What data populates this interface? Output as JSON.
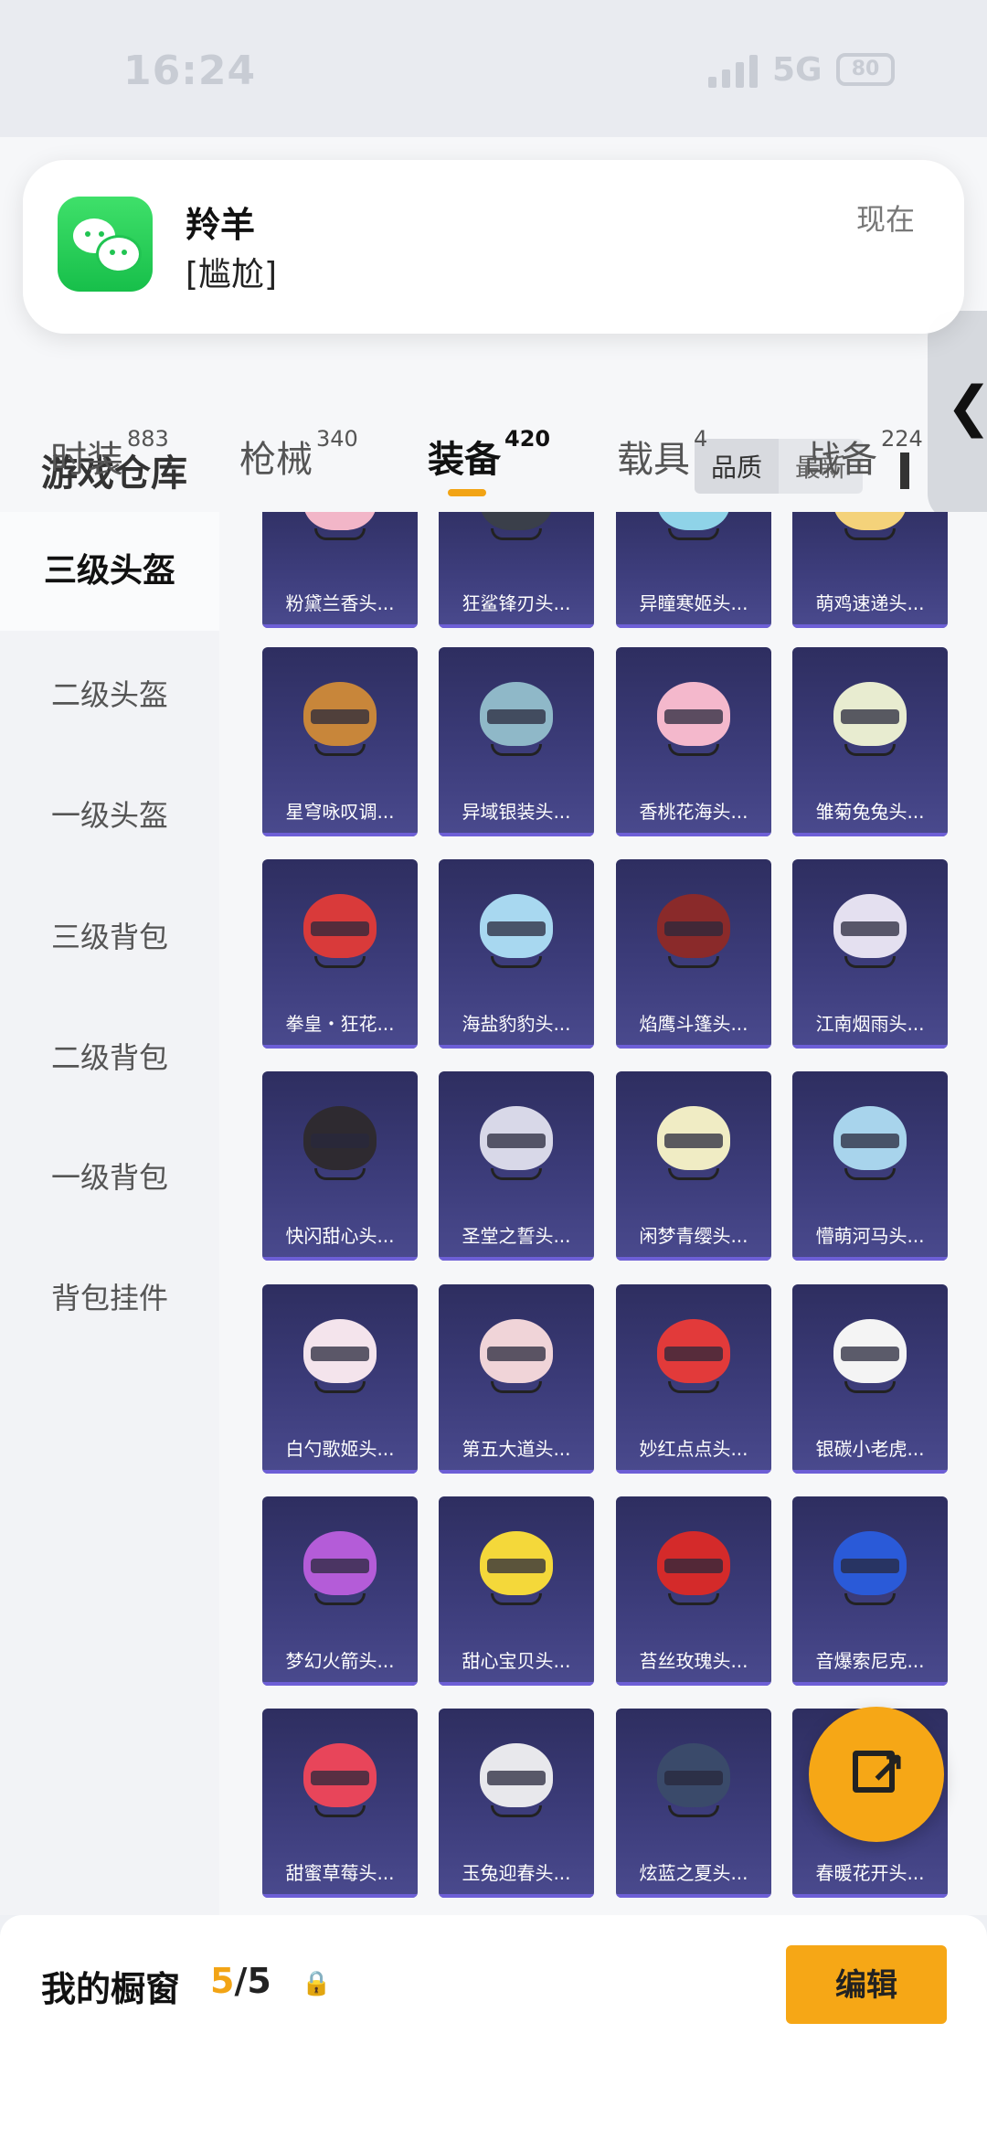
{
  "status_bar": {
    "time": "16:24",
    "network": "5G",
    "battery": "80"
  },
  "page": {
    "title": "游戏仓库",
    "sort_options": [
      "品质",
      "最新"
    ],
    "tabs": [
      {
        "label": "时装",
        "count": "883"
      },
      {
        "label": "枪械",
        "count": "340"
      },
      {
        "label": "装备",
        "count": "420"
      },
      {
        "label": "载具",
        "count": "4"
      },
      {
        "label": "战备",
        "count": "224"
      }
    ],
    "active_tab": "装备"
  },
  "notification": {
    "sender": "羚羊",
    "message": "[尴尬]",
    "time": "现在",
    "app_icon": "wechat-icon"
  },
  "sidebar": {
    "items": [
      "三级头盔",
      "二级头盔",
      "一级头盔",
      "三级背包",
      "二级背包",
      "一级背包",
      "背包挂件"
    ],
    "active": "三级头盔"
  },
  "items": [
    {
      "name": "粉黛兰香头...",
      "color": "#f2b6c8"
    },
    {
      "name": "狂鲨锋刃头...",
      "color": "#3a3f4a"
    },
    {
      "name": "异瞳寒姬头...",
      "color": "#8fd3e8"
    },
    {
      "name": "萌鸡速递头...",
      "color": "#f4d27a"
    },
    {
      "name": "星穹咏叹调...",
      "color": "#c8863a"
    },
    {
      "name": "异域银装头...",
      "color": "#8fb8c8"
    },
    {
      "name": "香桃花海头...",
      "color": "#f4b8cc"
    },
    {
      "name": "雏菊兔兔头...",
      "color": "#e8ecd0"
    },
    {
      "name": "拳皇・狂花...",
      "color": "#d93a3a"
    },
    {
      "name": "海盐豹豹头...",
      "color": "#a8d8f0"
    },
    {
      "name": "焰鹰斗篷头...",
      "color": "#8a2a2a"
    },
    {
      "name": "江南烟雨头...",
      "color": "#e4e0f0"
    },
    {
      "name": "快闪甜心头...",
      "color": "#2e2a30"
    },
    {
      "name": "圣堂之誓头...",
      "color": "#d8d8e8"
    },
    {
      "name": "闲梦青缨头...",
      "color": "#f0ecc4"
    },
    {
      "name": "懵萌河马头...",
      "color": "#a8d4ec"
    },
    {
      "name": "白勺歌姬头...",
      "color": "#f4e4ec"
    },
    {
      "name": "第五大道头...",
      "color": "#f0d4d8"
    },
    {
      "name": "妙红点点头...",
      "color": "#e23a3a"
    },
    {
      "name": "银碳小老虎...",
      "color": "#f4f4f4"
    },
    {
      "name": "梦幻火箭头...",
      "color": "#b45cd8"
    },
    {
      "name": "甜心宝贝头...",
      "color": "#f4d83a"
    },
    {
      "name": "苔丝玫瑰头...",
      "color": "#d42a2a"
    },
    {
      "name": "音爆索尼克...",
      "color": "#2a5ad8"
    },
    {
      "name": "甜蜜草莓头...",
      "color": "#e8455a"
    },
    {
      "name": "玉兔迎春头...",
      "color": "#e8e8ec"
    },
    {
      "name": "炫蓝之夏头...",
      "color": "#3a4a6a"
    },
    {
      "name": "春暖花开头...",
      "color": "#f0c4d4"
    }
  ],
  "showcase": {
    "label": "我的橱窗",
    "current": "5",
    "total": "/5",
    "lock_icon": "lock-icon"
  },
  "edit_button": "编辑",
  "accent_color": "#f6a716"
}
